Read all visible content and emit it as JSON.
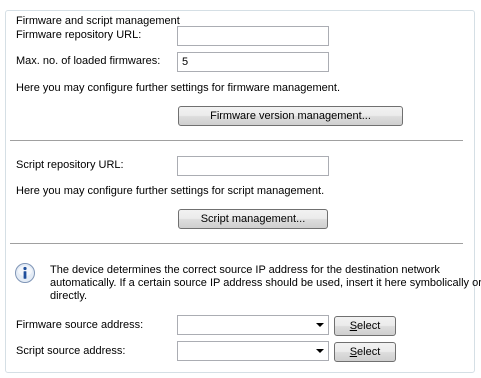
{
  "group": {
    "title": "Firmware and script management"
  },
  "firmware": {
    "repo_label": "Firmware repository URL:",
    "repo_value": "",
    "max_label": "Max. no. of loaded firmwares:",
    "max_value": "5",
    "hint": "Here you may configure further settings for firmware management.",
    "button_label": "Firmware version management..."
  },
  "script": {
    "repo_label": "Script repository URL:",
    "repo_value": "",
    "hint": "Here you may configure further settings for script management.",
    "button_label": "Script management..."
  },
  "info": {
    "icon": "info-icon",
    "line1": "The device determines the correct source IP address for the destination network",
    "line2": "automatically. If a certain source IP address should be used, insert it here symbolically or",
    "line3": "directly."
  },
  "source": {
    "firmware_label": "Firmware source address:",
    "firmware_value": "",
    "script_label": "Script source address:",
    "script_value": "",
    "select_prefix": "S",
    "select_rest": "elect"
  }
}
